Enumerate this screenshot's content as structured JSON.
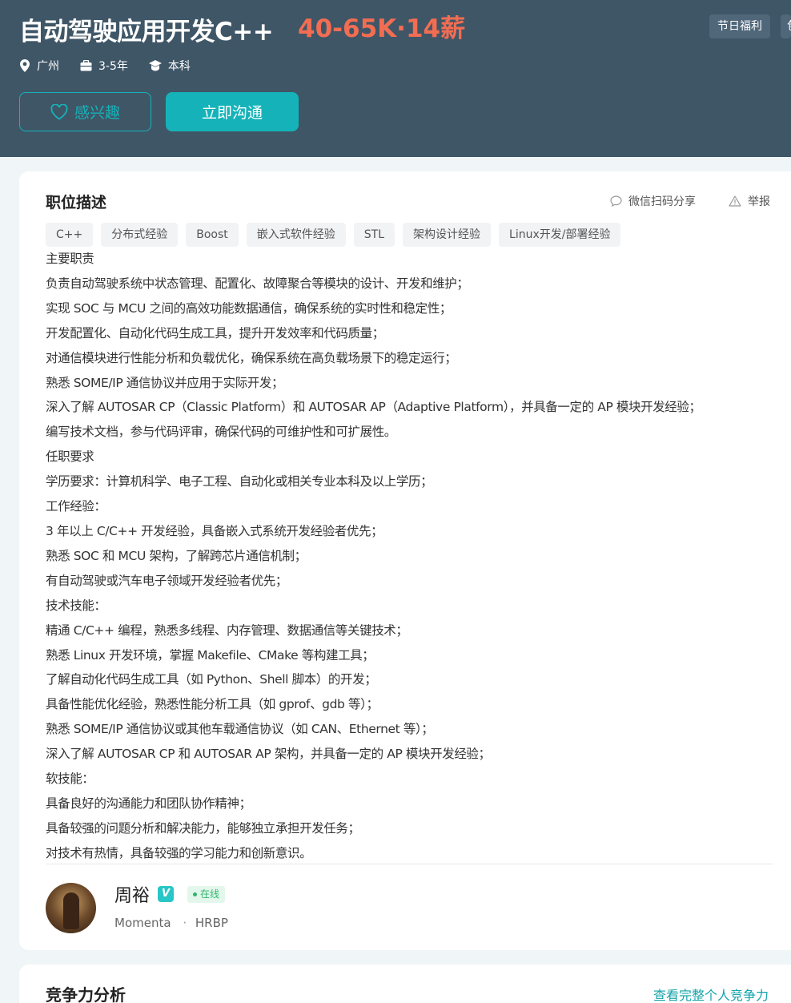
{
  "job": {
    "title": "自动驾驶应用开发C++",
    "salary": "40-65K·14薪",
    "tags": [
      "节日福利",
      "包"
    ],
    "city": "广州",
    "experience": "3-5年",
    "degree": "本科",
    "interest_label": "感兴趣",
    "chat_label": "立即沟通"
  },
  "description": {
    "title": "职位描述",
    "share_label": "微信扫码分享",
    "report_label": "举报",
    "skills": [
      "C++",
      "分布式经验",
      "Boost",
      "嵌入式软件经验",
      "STL",
      "架构设计经验",
      "Linux开发/部署经验"
    ],
    "lines": [
      "主要职责",
      "负责自动驾驶系统中状态管理、配置化、故障聚合等模块的设计、开发和维护；",
      "实现 SOC 与 MCU 之间的高效功能数据通信，确保系统的实时性和稳定性；",
      "开发配置化、自动化代码生成工具，提升开发效率和代码质量；",
      "对通信模块进行性能分析和负载优化，确保系统在高负载场景下的稳定运行；",
      "熟悉 SOME/IP 通信协议并应用于实际开发；",
      "深入了解 AUTOSAR CP（Classic Platform）和 AUTOSAR AP（Adaptive Platform），并具备一定的 AP 模块开发经验；",
      "编写技术文档，参与代码评审，确保代码的可维护性和可扩展性。",
      "任职要求",
      "学历要求：计算机科学、电子工程、自动化或相关专业本科及以上学历；",
      "工作经验：",
      "3 年以上 C/C++ 开发经验，具备嵌入式系统开发经验者优先；",
      "熟悉 SOC 和 MCU 架构，了解跨芯片通信机制；",
      "有自动驾驶或汽车电子领域开发经验者优先；",
      "技术技能：",
      "精通 C/C++ 编程，熟悉多线程、内存管理、数据通信等关键技术；",
      "熟悉 Linux 开发环境，掌握 Makefile、CMake 等构建工具；",
      "了解自动化代码生成工具（如 Python、Shell 脚本）的开发；",
      "具备性能优化经验，熟悉性能分析工具（如 gprof、gdb 等）；",
      "熟悉 SOME/IP 通信协议或其他车载通信协议（如 CAN、Ethernet 等）；",
      "深入了解 AUTOSAR CP 和 AUTOSAR AP 架构，并具备一定的 AP 模块开发经验；",
      "软技能：",
      "具备良好的沟通能力和团队协作精神；",
      "具备较强的问题分析和解决能力，能够独立承担开发任务；",
      "对技术有热情，具备较强的学习能力和创新意识。"
    ]
  },
  "recruiter": {
    "name": "周裕",
    "verified_mark": "V",
    "status": "在线",
    "company": "Momenta",
    "separator": "·",
    "role": "HRBP"
  },
  "competition": {
    "title": "竞争力分析",
    "link_label": "查看完整个人竞争力"
  },
  "colors": {
    "header_bg": "#3f5667",
    "salary": "#f26d52",
    "accent": "#15b3b9"
  }
}
